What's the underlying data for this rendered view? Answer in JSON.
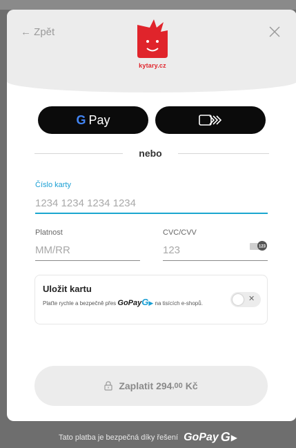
{
  "header": {
    "back_label": "← Zpět",
    "logo_caption": "kytary.cz"
  },
  "wallets": {
    "gpay_g": "G",
    "gpay_label": "Pay"
  },
  "separator": {
    "label": "nebo"
  },
  "card": {
    "label": "Číslo karty",
    "placeholder": "1234 1234 1234 1234"
  },
  "expiry": {
    "label": "Platnost",
    "placeholder": "MM/RR"
  },
  "cvc": {
    "label": "CVC/CVV",
    "placeholder": "123",
    "icon_text": "123"
  },
  "save_card": {
    "title": "Uložit kartu",
    "desc_before": "Plaťte rychle a bezpečně přes",
    "gopay": "GoPay",
    "gopay_g": "G",
    "desc_after": "na tisících e-shopů."
  },
  "submit": {
    "label": "Zaplatit",
    "amount": "294",
    "decimals": ",00",
    "currency": "Kč"
  },
  "footer": {
    "text": "Tato platba je bezpečná díky řešení",
    "gopay": "GoPay",
    "gopay_g": "G"
  },
  "colors": {
    "accent": "#1aa6cf",
    "brand_red": "#e0242b"
  }
}
